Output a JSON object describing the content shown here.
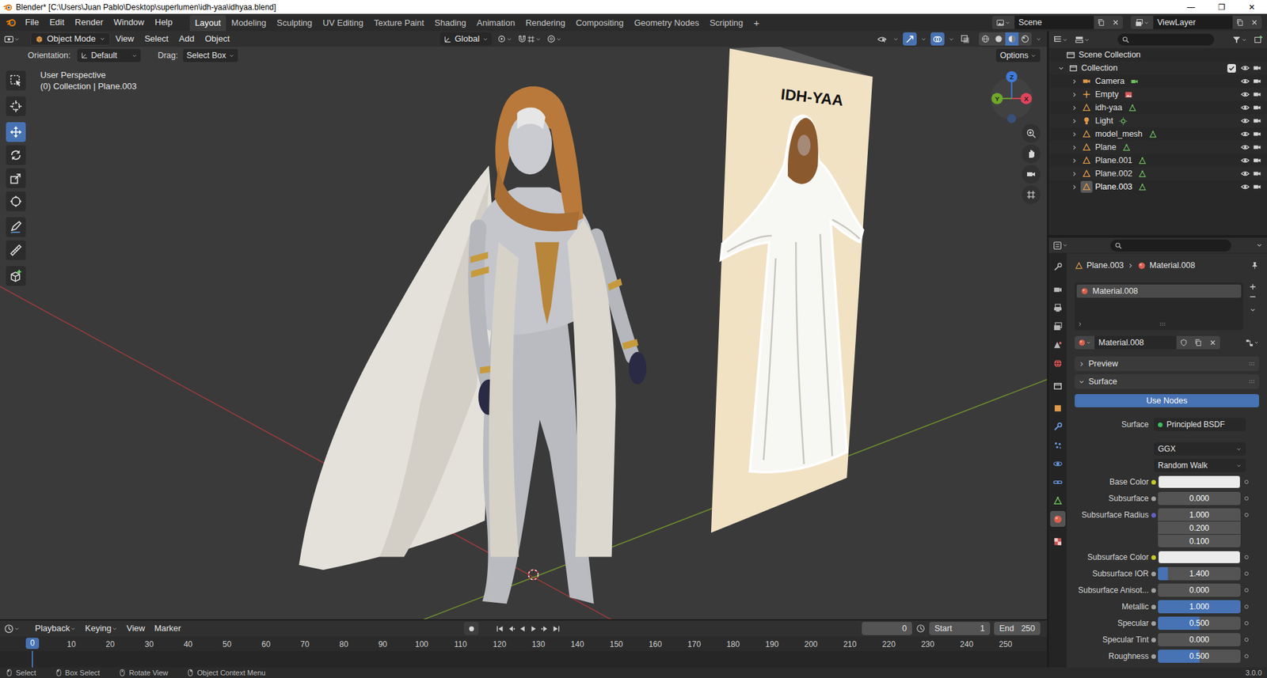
{
  "window": {
    "title": "Blender* [C:\\Users\\Juan Pablo\\Desktop\\superlumen\\idh-yaa\\idhyaa.blend]",
    "controls": [
      "—",
      "❐",
      "✕"
    ]
  },
  "menu": [
    "File",
    "Edit",
    "Render",
    "Window",
    "Help"
  ],
  "workspaces": [
    {
      "label": "Layout",
      "selected": true
    },
    {
      "label": "Modeling",
      "selected": false
    },
    {
      "label": "Sculpting",
      "selected": false
    },
    {
      "label": "UV Editing",
      "selected": false
    },
    {
      "label": "Texture Paint",
      "selected": false
    },
    {
      "label": "Shading",
      "selected": false
    },
    {
      "label": "Animation",
      "selected": false
    },
    {
      "label": "Rendering",
      "selected": false
    },
    {
      "label": "Compositing",
      "selected": false
    },
    {
      "label": "Geometry Nodes",
      "selected": false
    },
    {
      "label": "Scripting",
      "selected": false
    }
  ],
  "workspace_add": "+",
  "scene": "Scene",
  "view_layer": "ViewLayer",
  "viewport": {
    "mode": "Object Mode",
    "menus": [
      "View",
      "Select",
      "Add",
      "Object"
    ],
    "orientation": "Global",
    "toggles": [
      {
        "kind": "visibility",
        "on": false
      },
      {
        "kind": "gizmos",
        "on": true
      },
      {
        "kind": "overlays",
        "on": true
      },
      {
        "kind": "xray",
        "on": false
      }
    ],
    "shading": [
      {
        "kind": "wireframe",
        "selected": false
      },
      {
        "kind": "solid",
        "selected": false
      },
      {
        "kind": "material",
        "selected": true
      },
      {
        "kind": "rendered",
        "selected": false
      }
    ],
    "tool_settings": {
      "orientation_label": "Orientation:",
      "orientation": "Default",
      "drag_label": "Drag:",
      "drag": "Select Box",
      "options": "Options"
    },
    "overlay_lines": [
      "User Perspective",
      "(0) Collection | Plane.003"
    ],
    "tools": [
      {
        "kind": "select",
        "selected": false
      },
      {
        "kind": "cursor",
        "selected": false
      },
      {
        "kind": "move",
        "selected": true
      },
      {
        "kind": "rotate",
        "selected": false
      },
      {
        "kind": "scale",
        "selected": false
      },
      {
        "kind": "transform",
        "selected": false
      },
      {
        "kind": "annotate",
        "selected": false
      },
      {
        "kind": "measure",
        "selected": false
      },
      {
        "kind": "add-cube",
        "selected": false
      }
    ],
    "gizmo": {
      "x": "X",
      "y": "Y",
      "z": "Z"
    },
    "poster_title": "IDH-YAA"
  },
  "outliner": {
    "root": "Scene Collection",
    "collection": {
      "name": "Collection",
      "checked": true
    },
    "items": [
      {
        "name": "Camera",
        "kind": "camera",
        "selected": false
      },
      {
        "name": "Empty",
        "kind": "image-empty",
        "selected": false
      },
      {
        "name": "idh-yaa",
        "kind": "mesh",
        "selected": false
      },
      {
        "name": "Light",
        "kind": "light",
        "selected": false
      },
      {
        "name": "model_mesh",
        "kind": "mesh",
        "selected": false
      },
      {
        "name": "Plane",
        "kind": "mesh",
        "selected": false
      },
      {
        "name": "Plane.001",
        "kind": "mesh",
        "selected": false
      },
      {
        "name": "Plane.002",
        "kind": "mesh",
        "selected": false
      },
      {
        "name": "Plane.003",
        "kind": "mesh",
        "selected": true
      }
    ]
  },
  "properties": {
    "tabs": [
      {
        "kind": "tool",
        "selected": false
      },
      {
        "kind": "render",
        "selected": false
      },
      {
        "kind": "output",
        "selected": false
      },
      {
        "kind": "view-layer",
        "selected": false
      },
      {
        "kind": "scene",
        "selected": false
      },
      {
        "kind": "world",
        "selected": false
      },
      {
        "kind": "collection",
        "selected": false
      },
      {
        "kind": "object",
        "selected": false
      },
      {
        "kind": "modifiers",
        "selected": false
      },
      {
        "kind": "particles",
        "selected": false
      },
      {
        "kind": "physics",
        "selected": false
      },
      {
        "kind": "constraints",
        "selected": false
      },
      {
        "kind": "data",
        "selected": false
      },
      {
        "kind": "material",
        "selected": true
      },
      {
        "kind": "texture",
        "selected": false
      }
    ],
    "breadcrumb": [
      "Plane.003",
      "Material.008"
    ],
    "slots": [
      {
        "name": "Material.008",
        "selected": true
      }
    ],
    "material_name": "Material.008",
    "panels": [
      {
        "label": "Preview",
        "expanded": false
      },
      {
        "label": "Surface",
        "expanded": true
      }
    ],
    "use_nodes": "Use Nodes",
    "rows": [
      {
        "kind": "dropdown",
        "label": "Surface",
        "value": "Principled BSDF",
        "socket": "#3fbf5a"
      },
      {
        "kind": "dropdown",
        "value": "GGX"
      },
      {
        "kind": "dropdown",
        "value": "Random Walk"
      },
      {
        "kind": "color",
        "label": "Base Color",
        "swatch": "#ebebeb",
        "socket": "#c7c729"
      },
      {
        "kind": "slider",
        "label": "Subsurface",
        "value": "0.000",
        "level": 0,
        "socket": "#a1a1a1"
      },
      {
        "kind": "vector",
        "label": "Subsurface Radius",
        "values": [
          "1.000",
          "0.200",
          "0.100"
        ],
        "socket": "#6363c7"
      },
      {
        "kind": "color",
        "label": "Subsurface Color",
        "swatch": "#ebebeb",
        "socket": "#c7c729"
      },
      {
        "kind": "slider",
        "label": "Subsurface IOR",
        "value": "1.400",
        "level": 0.12,
        "socket": "#a1a1a1"
      },
      {
        "kind": "slider",
        "label": "Subsurface Anisot...",
        "value": "0.000",
        "level": 0,
        "socket": "#a1a1a1"
      },
      {
        "kind": "slider",
        "label": "Metallic",
        "value": "1.000",
        "level": 1,
        "socket": "#a1a1a1"
      },
      {
        "kind": "slider",
        "label": "Specular",
        "value": "0.500",
        "level": 0.5,
        "socket": "#a1a1a1"
      },
      {
        "kind": "slider",
        "label": "Specular Tint",
        "value": "0.000",
        "level": 0,
        "socket": "#a1a1a1"
      },
      {
        "kind": "slider",
        "label": "Roughness",
        "value": "0.500",
        "level": 0.5,
        "socket": "#a1a1a1"
      }
    ]
  },
  "timeline": {
    "menus": [
      "Playback",
      "Keying",
      "View",
      "Marker"
    ],
    "frame": "0",
    "start_label": "Start",
    "start": "1",
    "end_label": "End",
    "end": "250",
    "playhead": "0",
    "ticks": [
      "10",
      "20",
      "30",
      "40",
      "50",
      "60",
      "70",
      "80",
      "90",
      "100",
      "110",
      "120",
      "130",
      "140",
      "150",
      "160",
      "170",
      "180",
      "190",
      "200",
      "210",
      "220",
      "230",
      "240",
      "250"
    ]
  },
  "status_bar": {
    "hints": [
      "Select",
      "Box Select",
      "Rotate View",
      "Object Context Menu"
    ],
    "version": "3.0.0"
  }
}
